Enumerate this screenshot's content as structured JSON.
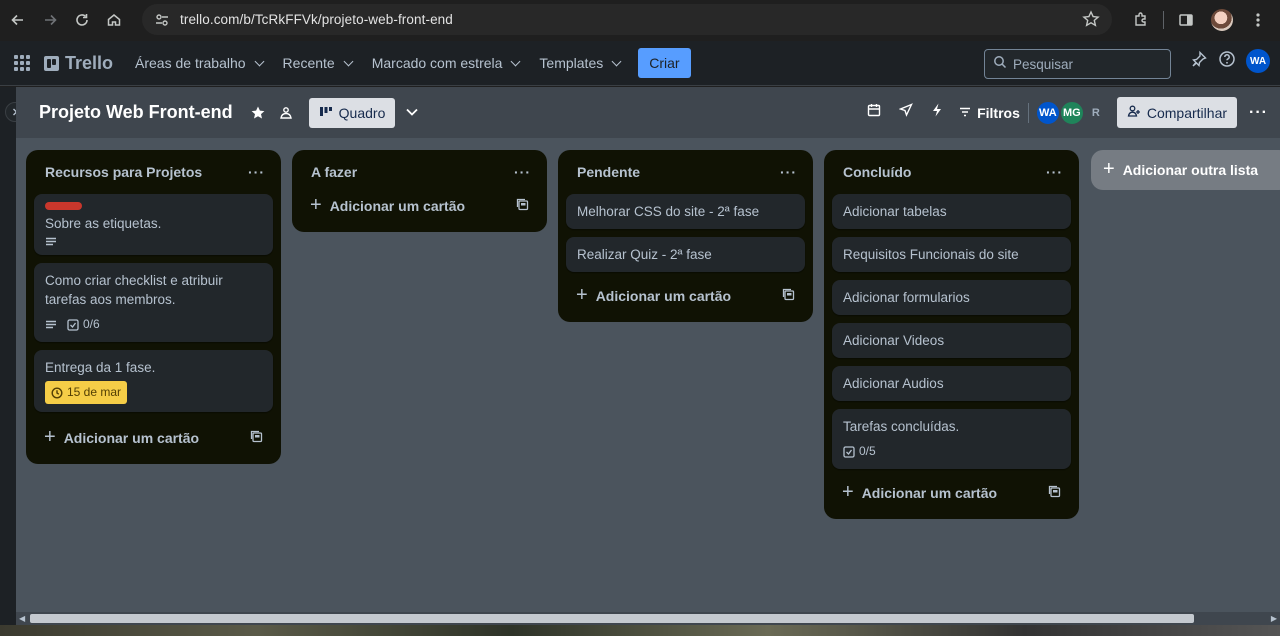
{
  "browser": {
    "url": "trello.com/b/TcRkFFVk/projeto-web-front-end"
  },
  "header": {
    "logo_text": "Trello",
    "menu": [
      {
        "label": "Áreas de trabalho"
      },
      {
        "label": "Recente"
      },
      {
        "label": "Marcado com estrela"
      },
      {
        "label": "Templates"
      }
    ],
    "create_label": "Criar",
    "search_placeholder": "Pesquisar",
    "avatar_initials": "WA"
  },
  "board": {
    "title": "Projeto Web Front-end",
    "view_label": "Quadro",
    "filters_label": "Filtros",
    "members": [
      {
        "initials": "WA",
        "color": "#0055cc"
      },
      {
        "initials": "MG",
        "color": "#1f845a"
      },
      {
        "initials": "R",
        "color": "transparent"
      }
    ],
    "share_label": "Compartilhar"
  },
  "lists": [
    {
      "title": "Recursos para Projetos",
      "cards": [
        {
          "text": "Sobre as etiquetas.",
          "label_color": "#c9372c",
          "has_description": true
        },
        {
          "text": "Como criar checklist e atribuir tarefas aos membros.",
          "has_description": true,
          "checklist": "0/6"
        },
        {
          "text": "Entrega da 1 fase.",
          "due": "15 de mar"
        }
      ],
      "add_label": "Adicionar um cartão"
    },
    {
      "title": "A fazer",
      "cards": [],
      "add_label": "Adicionar um cartão"
    },
    {
      "title": "Pendente",
      "cards": [
        {
          "text": "Melhorar CSS do site - 2ª fase"
        },
        {
          "text": "Realizar Quiz - 2ª fase"
        }
      ],
      "add_label": "Adicionar um cartão"
    },
    {
      "title": "Concluído",
      "cards": [
        {
          "text": "Adicionar tabelas"
        },
        {
          "text": "Requisitos Funcionais do site"
        },
        {
          "text": "Adicionar formularios"
        },
        {
          "text": "Adicionar Videos"
        },
        {
          "text": "Adicionar Audios"
        },
        {
          "text": "Tarefas concluídas.",
          "checklist": "0/5"
        }
      ],
      "add_label": "Adicionar um cartão"
    }
  ],
  "add_list_label": "Adicionar outra lista"
}
